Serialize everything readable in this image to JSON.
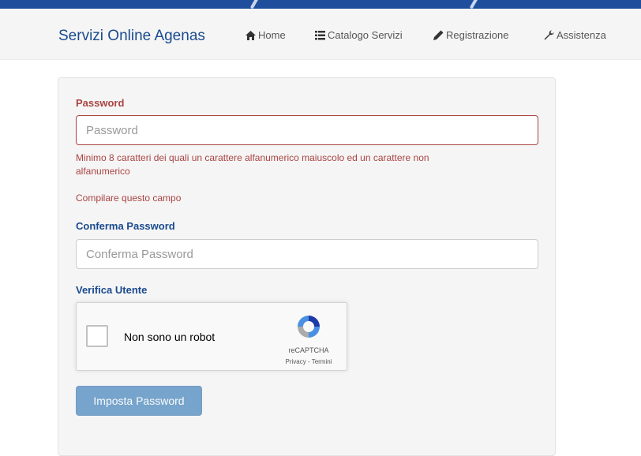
{
  "navbar": {
    "brand": "Servizi Online Agenas",
    "links": [
      {
        "label": "Home",
        "icon": "home-icon"
      },
      {
        "label": "Catalogo Servizi",
        "icon": "list-icon"
      },
      {
        "label": "Registrazione",
        "icon": "pencil-icon"
      },
      {
        "label": "Assistenza",
        "icon": "wrench-icon"
      }
    ]
  },
  "form": {
    "password": {
      "label": "Password",
      "placeholder": "Password",
      "hint_line1": "Minimo 8 caratteri dei quali un carattere alfanumerico maiuscolo ed un carattere non",
      "hint_line2": "alfanumerico",
      "error": "Compilare questo campo"
    },
    "confirm": {
      "label": "Conferma Password",
      "placeholder": "Conferma Password"
    },
    "verify": {
      "label": "Verifica Utente"
    },
    "recaptcha": {
      "checkbox_label": "Non sono un robot",
      "brand": "reCAPTCHA",
      "terms": "Privacy - Termini"
    },
    "submit_label": "Imposta Password"
  },
  "colors": {
    "topbar": "#1f4f9c",
    "brand": "#1a4a8e",
    "error": "#a94442",
    "button": "#337ab7"
  }
}
